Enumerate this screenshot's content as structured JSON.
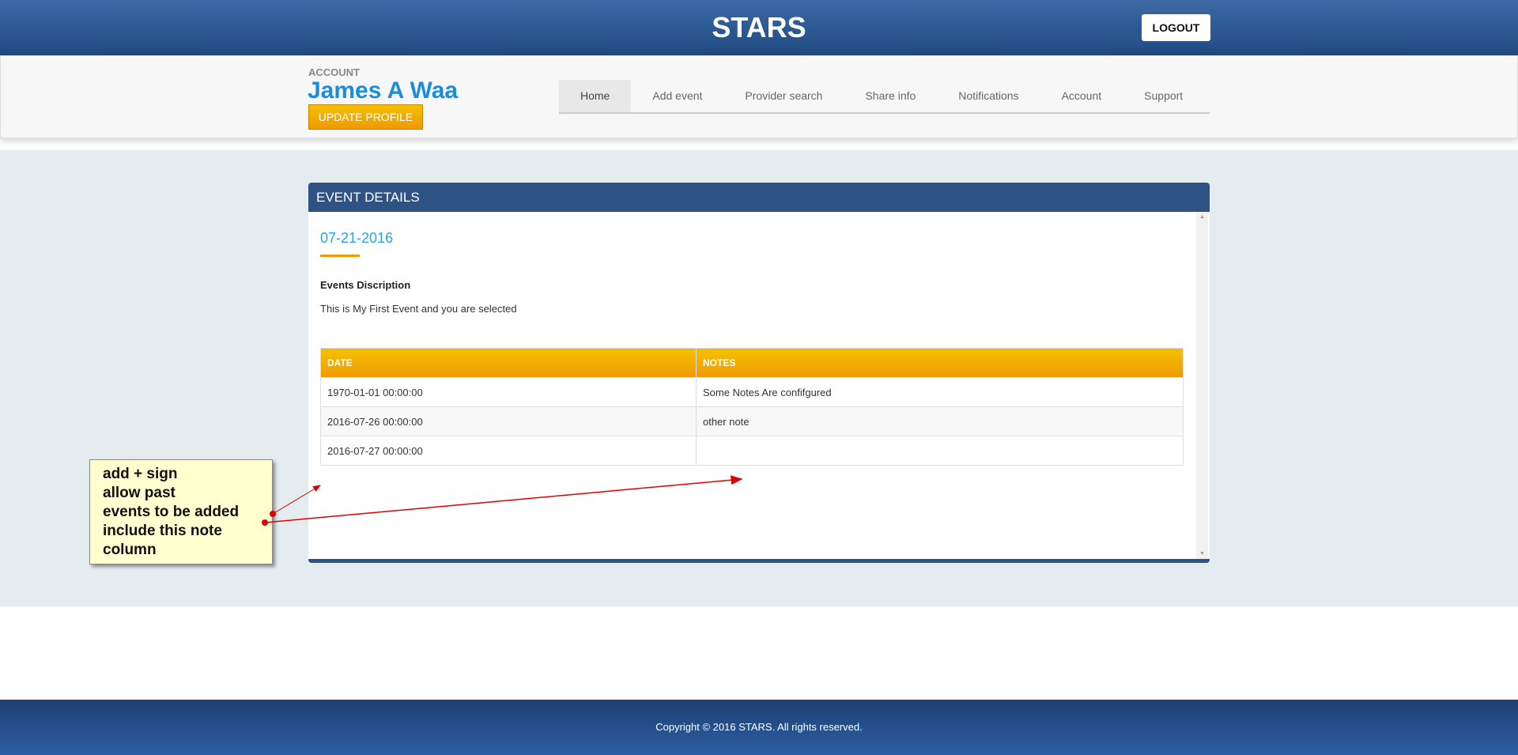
{
  "header": {
    "title": "STARS",
    "logout_label": "LOGOUT"
  },
  "account": {
    "label": "ACCOUNT",
    "name": "James A Waa",
    "update_label": "UPDATE PROFILE"
  },
  "nav": {
    "items": [
      {
        "label": "Home"
      },
      {
        "label": "Add event"
      },
      {
        "label": "Provider search"
      },
      {
        "label": "Share info"
      },
      {
        "label": "Notifications"
      },
      {
        "label": "Account"
      },
      {
        "label": "Support"
      }
    ],
    "active": "Home"
  },
  "panel": {
    "title": "EVENT DETAILS",
    "date": "07-21-2016",
    "desc_label": "Events Discription",
    "desc": "This is My First Event and you are selected",
    "table": {
      "headers": [
        "DATE",
        "NOTES"
      ],
      "rows": [
        [
          "1970-01-01 00:00:00",
          "Some Notes Are confifgured"
        ],
        [
          "2016-07-26 00:00:00",
          "other note"
        ],
        [
          "2016-07-27 00:00:00",
          ""
        ]
      ]
    }
  },
  "annotation": {
    "lines": [
      "add + sign",
      "allow past",
      "events to be added",
      "include this note",
      "column"
    ]
  },
  "footer": {
    "text": "Copyright © 2016 STARS. All rights reserved."
  }
}
